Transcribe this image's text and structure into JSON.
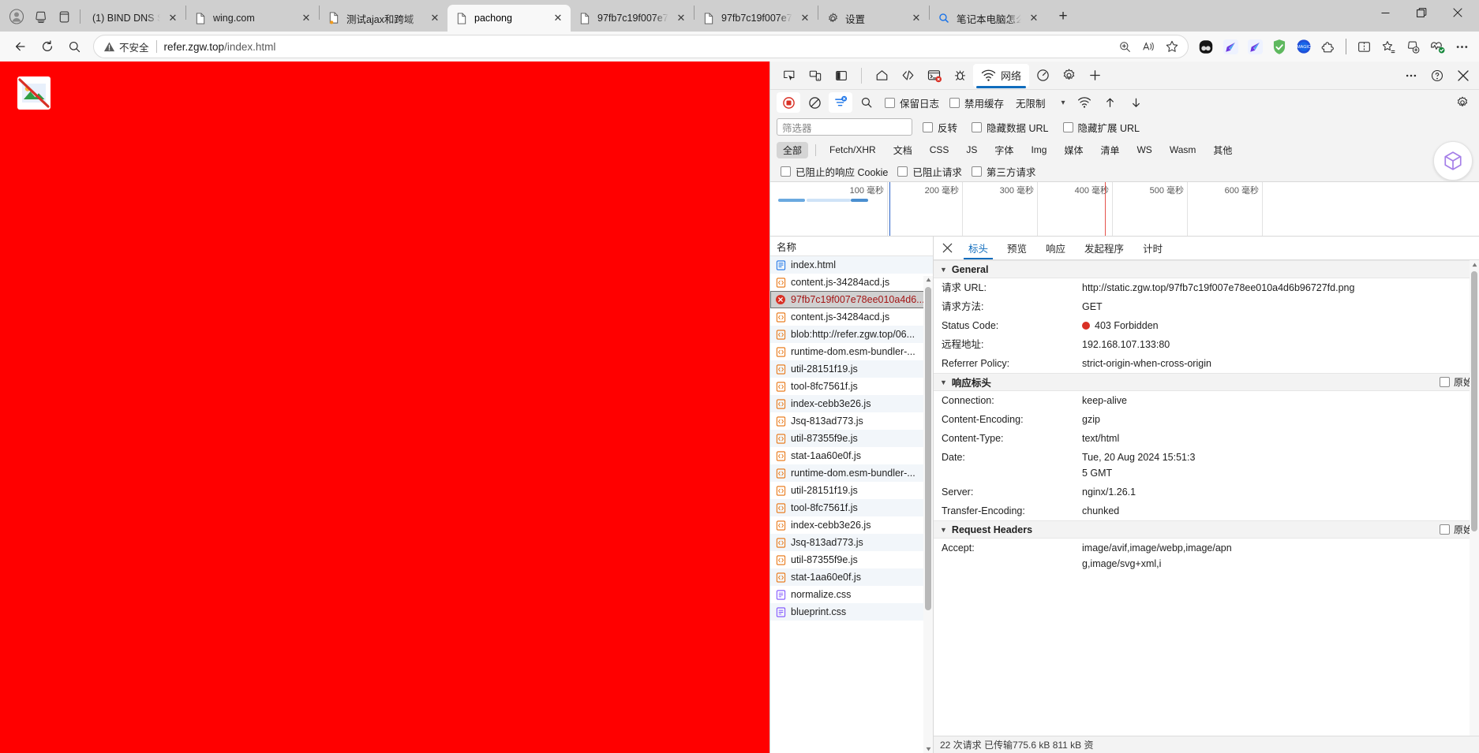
{
  "window": {
    "controls": {
      "minimize": "—",
      "restore": "❐",
      "close": "✕"
    }
  },
  "tabstrip": {
    "profile_icon": "profile-avatar-icon",
    "collections_icon": "collections-icon",
    "split_icon": "tab-list-icon",
    "new_tab_label": "+",
    "tabs": [
      {
        "title": "(1) BIND DNS S",
        "favicon": "none",
        "active": false,
        "close": "✕"
      },
      {
        "title": "wing.com",
        "favicon": "page",
        "active": false,
        "close": "✕"
      },
      {
        "title": "测试ajax和跨域",
        "favicon": "page-dot",
        "active": false,
        "close": "✕"
      },
      {
        "title": "pachong",
        "favicon": "page",
        "active": true,
        "close": "✕"
      },
      {
        "title": "97fb7c19f007e7",
        "favicon": "page",
        "active": false,
        "close": "✕"
      },
      {
        "title": "97fb7c19f007e7",
        "favicon": "page",
        "active": false,
        "close": "✕"
      },
      {
        "title": "设置",
        "favicon": "gear",
        "active": false,
        "close": "✕"
      },
      {
        "title": "笔记本电脑怎么",
        "favicon": "search",
        "active": false,
        "close": "✕"
      }
    ]
  },
  "navbar": {
    "back_icon": "back-arrow-icon",
    "reload_icon": "reload-icon",
    "search_icon": "search-icon",
    "security_label": "不安全",
    "url_host": "refer.zgw.top",
    "url_path": "/index.html",
    "zoom_icon": "zoom-in-icon",
    "read_aloud_icon": "read-aloud-icon",
    "favorite_icon": "favorite-star-icon",
    "extensions": [
      "copilot-icon",
      "extension-blue-arrow-1-icon",
      "extension-blue-arrow-2-icon",
      "adblock-shield-icon",
      "magic-extension-icon",
      "extensions-puzzle-icon"
    ],
    "right_icons": [
      "split-screen-icon",
      "favorites-list-icon",
      "collections-add-icon",
      "browser-essentials-icon",
      "settings-more-icon"
    ]
  },
  "devtools": {
    "toolbar": {
      "inspect_icon": "inspect-element-icon",
      "device_icon": "device-emulation-icon",
      "dock_icon": "dock-side-icon",
      "panels": [
        {
          "name": "welcome-icon",
          "label": ""
        },
        {
          "name": "elements-icon",
          "label": ""
        },
        {
          "name": "console-icon",
          "label": "",
          "badge": "error"
        },
        {
          "name": "sources-bug-icon",
          "label": ""
        }
      ],
      "active_panel_label": "网络",
      "active_panel_icon": "network-wifi-icon",
      "performance_icon": "performance-icon",
      "settings_icon": "settings-gear-icon",
      "more_panels_icon": "plus-icon",
      "overflow_icon": "more-horizontal-icon",
      "help_icon": "help-circle-icon",
      "close_icon": "close-icon"
    },
    "network_toolbar": {
      "record_icon": "record-stop-icon",
      "clear_icon": "clear-network-icon",
      "filter_icon": "filter-icon",
      "search_icon": "search-icon",
      "preserve_log": "保留日志",
      "disable_cache": "禁用缓存",
      "throttle_value": "无限制",
      "throttle_caret": "▾",
      "network_conditions_icon": "network-conditions-icon",
      "import_har_icon": "import-har-icon",
      "export_har_icon": "export-har-icon",
      "settings_icon": "network-settings-icon"
    },
    "filter": {
      "placeholder": "筛选器",
      "invert": "反转",
      "hide_data_urls": "隐藏数据 URL",
      "hide_extension_urls": "隐藏扩展 URL",
      "types": [
        "全部",
        "Fetch/XHR",
        "文档",
        "CSS",
        "JS",
        "字体",
        "Img",
        "媒体",
        "清单",
        "WS",
        "Wasm",
        "其他"
      ],
      "selected_type": "全部",
      "blocked_response_cookies": "已阻止的响应 Cookie",
      "blocked_requests": "已阻止请求",
      "third_party_requests": "第三方请求"
    },
    "overview": {
      "ticks": [
        "100 毫秒",
        "200 毫秒",
        "300 毫秒",
        "400 毫秒",
        "500 毫秒",
        "600 毫秒"
      ]
    },
    "request_list": {
      "column_header": "名称",
      "rows": [
        {
          "name": "index.html",
          "icon": "document-icon",
          "state": "normal"
        },
        {
          "name": "content.js-34284acd.js",
          "icon": "script-icon",
          "state": "normal"
        },
        {
          "name": "97fb7c19f007e78ee010a4d6...",
          "icon": "error-icon",
          "state": "selected"
        },
        {
          "name": "content.js-34284acd.js",
          "icon": "script-icon",
          "state": "normal"
        },
        {
          "name": "blob:http://refer.zgw.top/06...",
          "icon": "script-icon",
          "state": "normal"
        },
        {
          "name": "runtime-dom.esm-bundler-...",
          "icon": "script-icon",
          "state": "normal"
        },
        {
          "name": "util-28151f19.js",
          "icon": "script-icon",
          "state": "normal"
        },
        {
          "name": "tool-8fc7561f.js",
          "icon": "script-icon",
          "state": "normal"
        },
        {
          "name": "index-cebb3e26.js",
          "icon": "script-icon",
          "state": "normal"
        },
        {
          "name": "Jsq-813ad773.js",
          "icon": "script-icon",
          "state": "normal"
        },
        {
          "name": "util-87355f9e.js",
          "icon": "script-icon",
          "state": "normal"
        },
        {
          "name": "stat-1aa60e0f.js",
          "icon": "script-icon",
          "state": "normal"
        },
        {
          "name": "runtime-dom.esm-bundler-...",
          "icon": "script-icon",
          "state": "normal"
        },
        {
          "name": "util-28151f19.js",
          "icon": "script-icon",
          "state": "normal"
        },
        {
          "name": "tool-8fc7561f.js",
          "icon": "script-icon",
          "state": "normal"
        },
        {
          "name": "index-cebb3e26.js",
          "icon": "script-icon",
          "state": "normal"
        },
        {
          "name": "Jsq-813ad773.js",
          "icon": "script-icon",
          "state": "normal"
        },
        {
          "name": "util-87355f9e.js",
          "icon": "script-icon",
          "state": "normal"
        },
        {
          "name": "stat-1aa60e0f.js",
          "icon": "script-icon",
          "state": "normal"
        },
        {
          "name": "normalize.css",
          "icon": "style-icon",
          "state": "normal"
        },
        {
          "name": "blueprint.css",
          "icon": "style-icon",
          "state": "normal"
        }
      ]
    },
    "detail": {
      "close_icon": "close-icon",
      "tabs": [
        "标头",
        "预览",
        "响应",
        "发起程序",
        "计时"
      ],
      "active_tab": "标头",
      "sections": [
        {
          "title": "General",
          "raw_label": null,
          "rows": [
            {
              "key": "请求 URL:",
              "value": "http://static.zgw.top/97fb7c19f007e78ee010a4d6b96727fd.png"
            },
            {
              "key": "请求方法:",
              "value": "GET"
            },
            {
              "key": "Status Code:",
              "value": "403 Forbidden",
              "status": true
            },
            {
              "key": "远程地址:",
              "value": "192.168.107.133:80"
            },
            {
              "key": "Referrer Policy:",
              "value": "strict-origin-when-cross-origin"
            }
          ]
        },
        {
          "title": "响应标头",
          "raw_label": "原始",
          "rows": [
            {
              "key": "Connection:",
              "value": "keep-alive"
            },
            {
              "key": "Content-Encoding:",
              "value": "gzip"
            },
            {
              "key": "Content-Type:",
              "value": "text/html"
            },
            {
              "key": "Date:",
              "value": "Tue, 20 Aug 2024 15:51:35 GMT"
            },
            {
              "key": "Server:",
              "value": "nginx/1.26.1"
            },
            {
              "key": "Transfer-Encoding:",
              "value": "chunked"
            }
          ]
        },
        {
          "title": "Request Headers",
          "raw_label": "原始",
          "rows": [
            {
              "key": "Accept:",
              "value": "image/avif,image/webp,image/apng,image/svg+xml,i"
            }
          ]
        }
      ]
    },
    "status_bar": "22 次请求  已传输775.6 kB  811 kB 资"
  },
  "colors": {
    "page_background": "#ff0000",
    "accent": "#0f6cbd",
    "error": "#d93025",
    "selected_row_text": "#a31515"
  }
}
